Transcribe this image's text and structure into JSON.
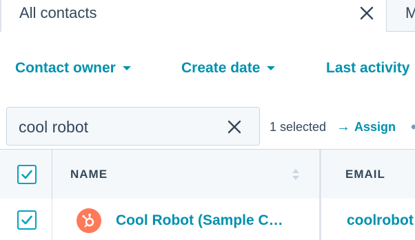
{
  "tabs": {
    "active_label": "All contacts",
    "next_label": "M"
  },
  "filters": [
    {
      "label": "Contact owner"
    },
    {
      "label": "Create date"
    },
    {
      "label": "Last activity"
    }
  ],
  "search": {
    "value": "cool robot"
  },
  "bulk": {
    "selected_text": "1 selected",
    "assign_label": "Assign",
    "assign_arrow": "→"
  },
  "table": {
    "header": {
      "name_label": "NAME",
      "email_label": "EMAIL",
      "all_checked": true
    },
    "rows": [
      {
        "checked": true,
        "name": "Cool Robot (Sample C…",
        "email": "coolrobot",
        "avatar_icon": "hubspot-sprocket-icon"
      }
    ]
  },
  "colors": {
    "link": "#0091ae",
    "text": "#33475b",
    "checkbox": "#00a4bd",
    "avatar_bg": "#ff7a59",
    "header_bg": "#f5f8fa",
    "border": "#cbd6e2"
  }
}
